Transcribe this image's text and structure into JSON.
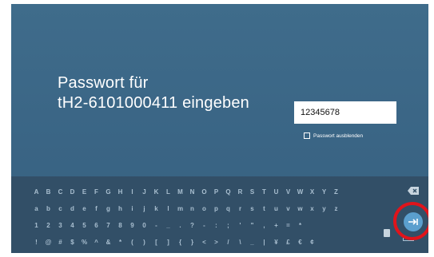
{
  "dialog": {
    "prompt_line1": "Passwort für",
    "prompt_line2": "tH2-6101000411 eingeben",
    "password_value": "12345678",
    "hide_password_label": "Passwort ausblenden"
  },
  "keyboard": {
    "rows": [
      [
        "A",
        "B",
        "C",
        "D",
        "E",
        "F",
        "G",
        "H",
        "I",
        "J",
        "K",
        "L",
        "M",
        "N",
        "O",
        "P",
        "Q",
        "R",
        "S",
        "T",
        "U",
        "V",
        "W",
        "X",
        "Y",
        "Z"
      ],
      [
        "a",
        "b",
        "c",
        "d",
        "e",
        "f",
        "g",
        "h",
        "i",
        "j",
        "k",
        "l",
        "m",
        "n",
        "o",
        "p",
        "q",
        "r",
        "s",
        "t",
        "u",
        "v",
        "w",
        "x",
        "y",
        "z"
      ],
      [
        "1",
        "2",
        "3",
        "4",
        "5",
        "6",
        "7",
        "8",
        "9",
        "0",
        "-",
        "_",
        ".",
        "?",
        "-",
        ":",
        ";",
        "'",
        "\"",
        ",",
        "+",
        "=",
        "*"
      ],
      [
        "!",
        "@",
        "#",
        "$",
        "%",
        "^",
        "&",
        "*",
        "(",
        ")",
        "[",
        "]",
        "{",
        "}",
        "<",
        ">",
        "/",
        "\\",
        "_",
        "|",
        "¥",
        "£",
        "€",
        "¢"
      ]
    ],
    "colors": {
      "key_text": "#a9bfd0",
      "enter_button": "#5b9fce",
      "highlight_ring": "#e0141b"
    },
    "icons": [
      "backspace-icon",
      "enter-icon",
      "delete-icon",
      "space-icon"
    ]
  }
}
